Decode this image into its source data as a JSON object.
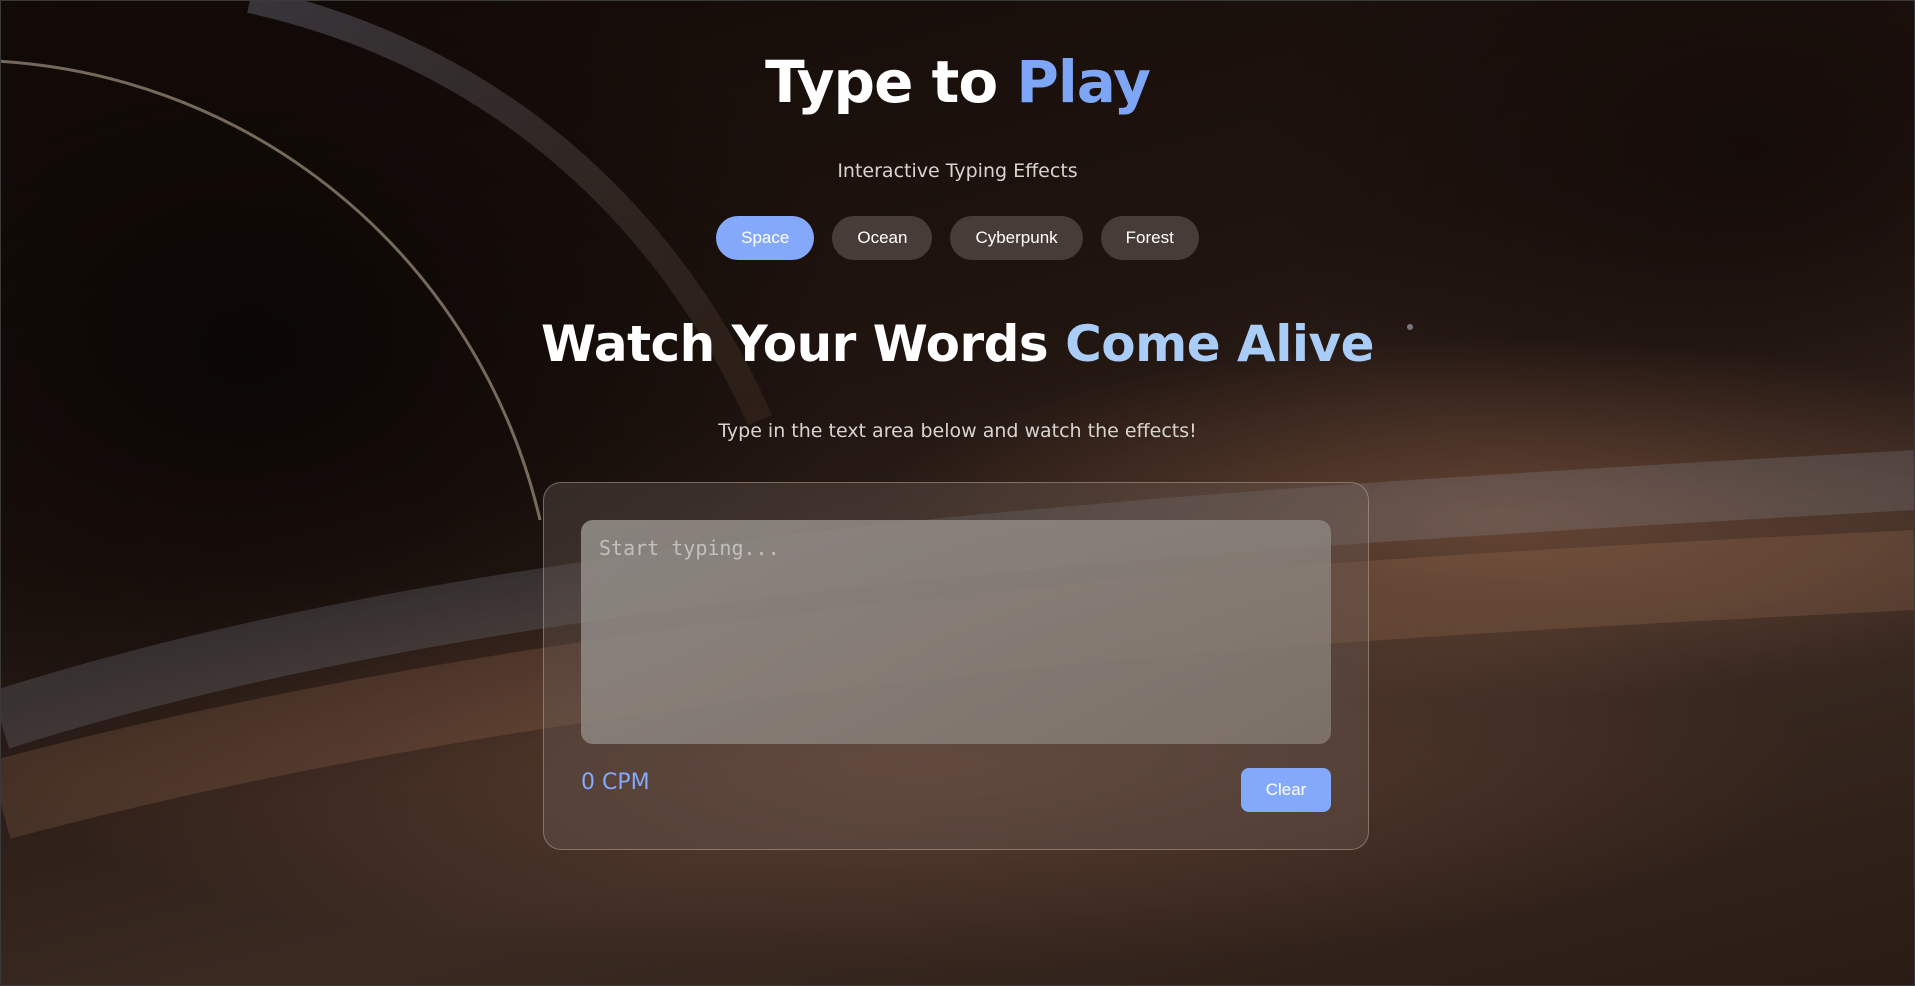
{
  "header": {
    "title_main": "Type to ",
    "title_accent": "Play",
    "subtitle": "Interactive Typing Effects"
  },
  "themes": [
    {
      "label": "Space",
      "active": true
    },
    {
      "label": "Ocean",
      "active": false
    },
    {
      "label": "Cyberpunk",
      "active": false
    },
    {
      "label": "Forest",
      "active": false
    }
  ],
  "hero": {
    "headline_main": "Watch Your Words ",
    "headline_accent": "Come Alive",
    "instruction": "Type in the text area below and watch the effects!"
  },
  "editor": {
    "value": "",
    "placeholder": "Start typing...",
    "cpm_text": "0 CPM",
    "clear_label": "Clear"
  },
  "colors": {
    "accent": "#84a9fb",
    "headline_accent": "#a9cdf7",
    "inactive_button": "#554b46"
  }
}
